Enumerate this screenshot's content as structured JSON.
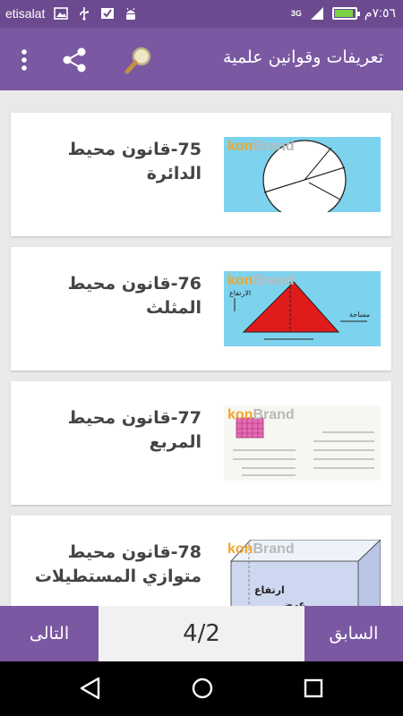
{
  "status_bar": {
    "carrier": "etisalat",
    "time": "٧:٥٦م",
    "network": "3G",
    "icons": [
      "image-icon",
      "usb-icon",
      "check-icon",
      "android-icon",
      "signal-icon",
      "battery-charging-icon"
    ],
    "battery_color": "#7bd142"
  },
  "app_bar": {
    "title": "تعريفات وقوانين علمية",
    "color": "#7a58a2",
    "icons": [
      "more-vert-icon",
      "share-icon",
      "search-icon"
    ]
  },
  "list": {
    "items": [
      {
        "title": "75-قانون محيط الدائرة",
        "thumbnail": "circle-diagram"
      },
      {
        "title": "76-قانون محيط المثلث",
        "thumbnail": "triangle-diagram"
      },
      {
        "title": "77-قانون محيط المربع",
        "thumbnail": "square-worksheet"
      },
      {
        "title": "78-قانون محيط متوازي المستطيلات",
        "thumbnail": "box-diagram"
      }
    ],
    "thumb_brand_a": "kon",
    "thumb_brand_b": "Brand",
    "labels": {
      "height": "ارتفاع",
      "width": "عرض",
      "area": "مساحة",
      "height_tri": "الارتفاع"
    }
  },
  "bottom_bar": {
    "next_label": "التالى",
    "prev_label": "السابق",
    "page_indicator": "4/2"
  },
  "nav_bar": {
    "icons": [
      "back-icon",
      "home-icon",
      "recents-icon"
    ]
  }
}
